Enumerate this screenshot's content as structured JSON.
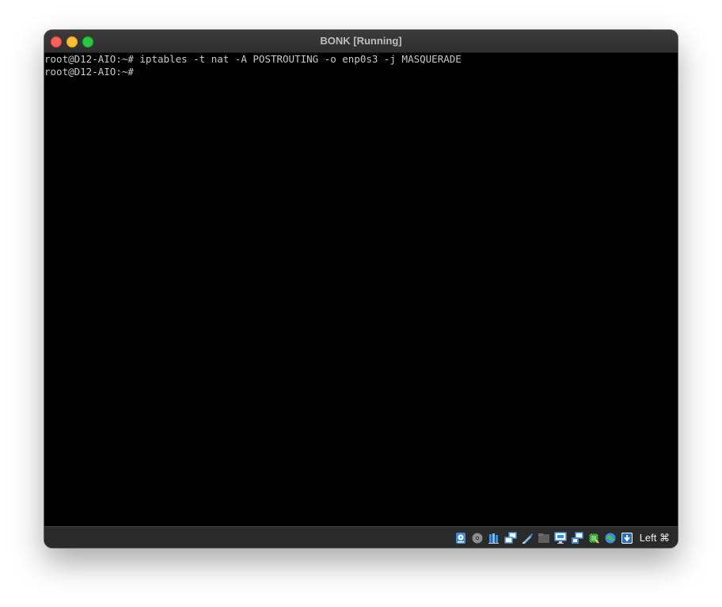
{
  "window": {
    "title": "BONK [Running]"
  },
  "console": {
    "lines": [
      "root@D12-AIO:~# iptables -t nat -A POSTROUTING -o enp0s3 -j MASQUERADE",
      "root@D12-AIO:~#"
    ]
  },
  "statusbar": {
    "icons": [
      "hard-disk-icon",
      "optical-disk-icon",
      "audio-icon",
      "network-icon",
      "usb-icon",
      "shared-folders-icon",
      "display-icon",
      "video-capture-icon",
      "cpu-icon",
      "guest-additions-icon",
      "mouse-integration-icon"
    ],
    "host_key_label": "Left ⌘"
  },
  "colors": {
    "close": "#ff5f57",
    "minimize": "#febc2e",
    "maximize": "#28c840",
    "console_bg": "#000000",
    "console_text": "#c8c8c8",
    "statusbar_bg": "#2a2a2a"
  }
}
